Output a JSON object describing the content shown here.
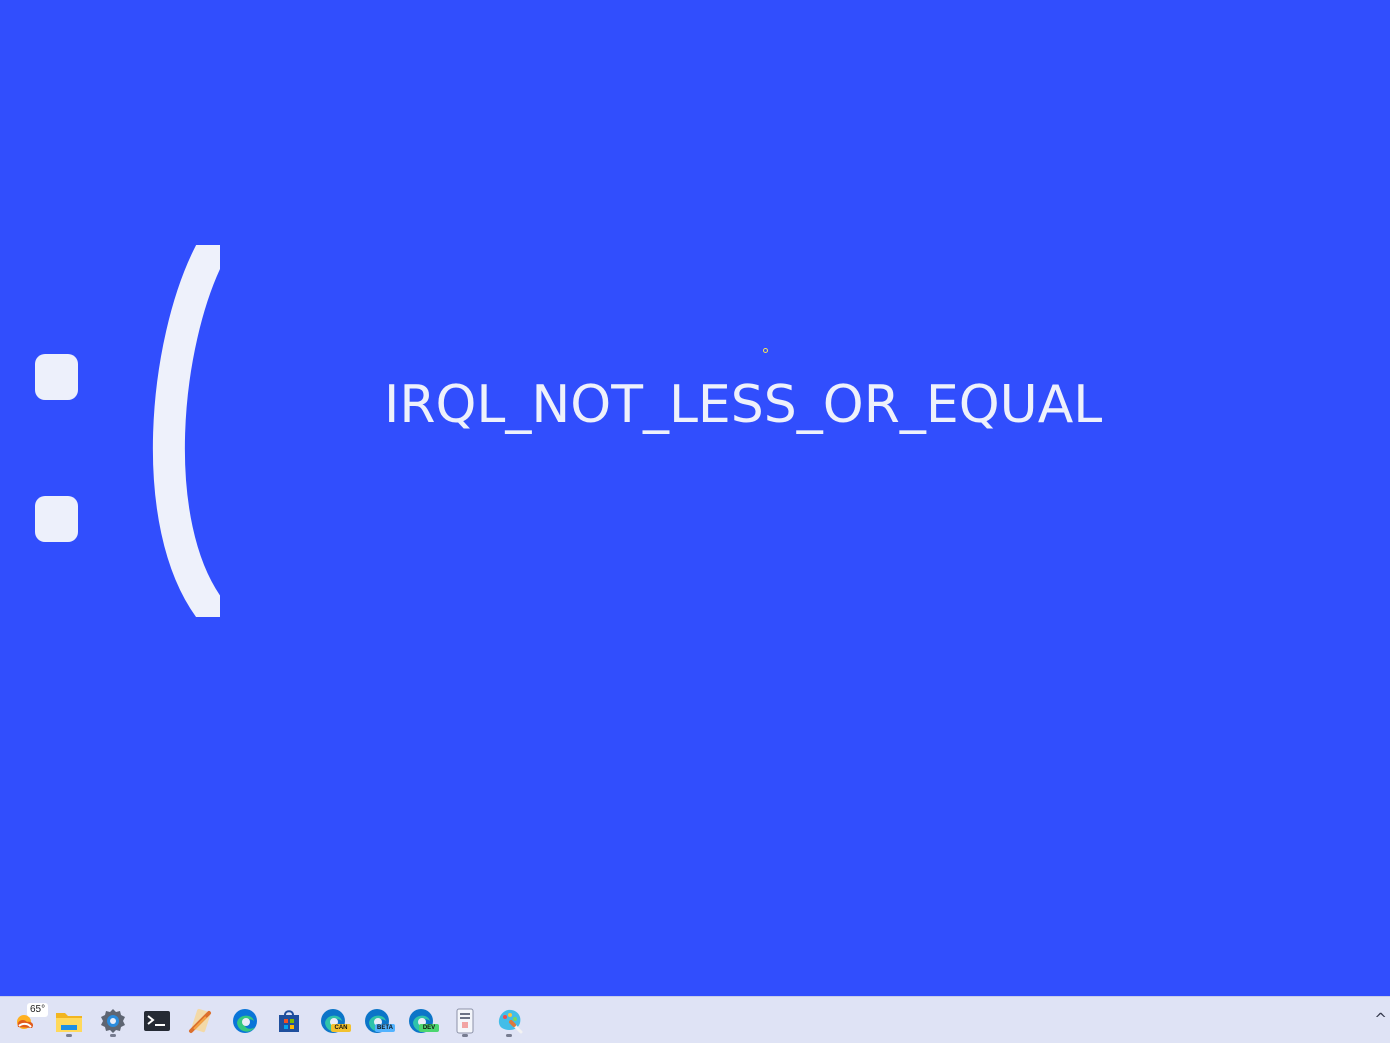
{
  "screen": {
    "background_color": "#314efd",
    "foreground_color": "#eef1fb",
    "error_code": "IRQL_NOT_LESS_OR_EQUAL",
    "sad_face": ":("
  },
  "taskbar": {
    "background_color": "#dfe3f5",
    "weather": {
      "temperature": "65°",
      "icon": "weather-sun-cloud-icon"
    },
    "apps": [
      {
        "name": "File Explorer",
        "icon": "file-explorer-icon",
        "running": true
      },
      {
        "name": "Settings",
        "icon": "settings-gear-icon",
        "running": true
      },
      {
        "name": "Terminal",
        "icon": "terminal-icon",
        "running": false
      },
      {
        "name": "Tools",
        "icon": "tools-icon",
        "running": false
      },
      {
        "name": "Microsoft Edge",
        "icon": "edge-icon",
        "running": false
      },
      {
        "name": "Microsoft Store",
        "icon": "store-icon",
        "running": false
      },
      {
        "name": "Microsoft Edge Canary",
        "icon": "edge-canary-icon",
        "label": "CAN",
        "running": false
      },
      {
        "name": "Microsoft Edge Beta",
        "icon": "edge-beta-icon",
        "label": "BETA",
        "running": false
      },
      {
        "name": "Microsoft Edge Dev",
        "icon": "edge-dev-icon",
        "label": "DEV",
        "running": false
      },
      {
        "name": "Notepad",
        "icon": "notepad-icon",
        "running": true
      },
      {
        "name": "Paint",
        "icon": "paint-icon",
        "running": true
      }
    ],
    "overflow_icon": "chevron-up-icon",
    "overflow_glyph": "^"
  }
}
